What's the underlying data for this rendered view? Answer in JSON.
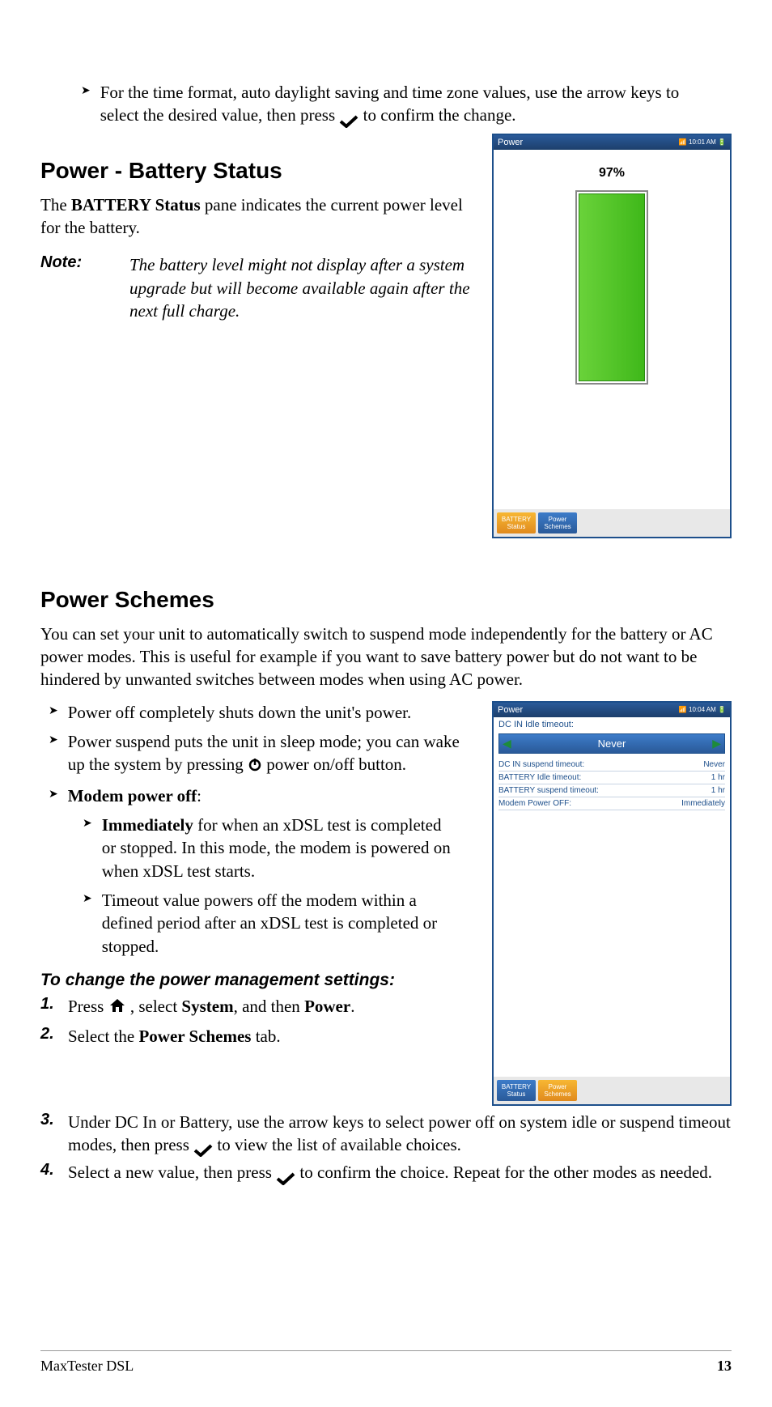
{
  "top_bullet": "For the time format, auto daylight saving and time zone values, use the arrow keys to select the desired value, then press ",
  "top_bullet_tail": " to confirm the change.",
  "h1": "Power - Battery Status",
  "battery_para_1": "The ",
  "battery_para_bold": "BATTERY Status",
  "battery_para_2": " pane indicates the current power level for the battery.",
  "note_label": "Note:",
  "note_text": "The battery level might not display after a system upgrade but will become available again after the next full charge.",
  "ss1": {
    "title": "Power",
    "time": "10:01 AM",
    "pct": "97%",
    "tab1": "BATTERY Status",
    "tab2": "Power Schemes"
  },
  "h2": "Power Schemes",
  "schemes_para": "You can set your unit to automatically switch to suspend mode independently for the battery or AC power modes. This is useful for example if you want to save battery power but do not want to be hindered by unwanted switches between modes when using AC power.",
  "sb1": "Power off completely shuts down the unit's power.",
  "sb2a": "Power suspend puts the unit in sleep mode; you can wake up the system by pressing",
  "sb2b": " power on/off button.",
  "sb3_bold": "Modem power off",
  "sb3_tail": ":",
  "sb3a_bold": "Immediately",
  "sb3a_tail": " for when an xDSL test is completed or stopped. In this mode, the modem is powered on when xDSL test starts.",
  "sb3b": "Timeout value powers off the modem within a defined period after an xDSL test is completed or stopped.",
  "instr_head": "To change the power management settings:",
  "step1a": "Press ",
  "step1b": " , select ",
  "step1_sys": "System",
  "step1c": ", and then ",
  "step1_pow": "Power",
  "step1d": ".",
  "step2a": "Select the ",
  "step2_bold": "Power Schemes",
  "step2b": " tab.",
  "step3a": "Under DC In or Battery, use the arrow keys to select power off on system idle or suspend timeout modes, then press ",
  "step3b": " to view the list of available choices.",
  "step4a": "Select a new value, then press ",
  "step4b": " to confirm the choice. Repeat for the other modes as needed.",
  "ss2": {
    "title": "Power",
    "time": "10:04 AM",
    "field_label": "DC IN Idle timeout:",
    "select_value": "Never",
    "rows": [
      {
        "k": "DC IN suspend timeout:",
        "v": "Never"
      },
      {
        "k": "BATTERY Idle timeout:",
        "v": "1 hr"
      },
      {
        "k": "BATTERY suspend timeout:",
        "v": "1 hr"
      },
      {
        "k": "Modem Power OFF:",
        "v": "Immediately"
      }
    ],
    "tab1": "BATTERY Status",
    "tab2": "Power Schemes"
  },
  "footer_left": "MaxTester DSL",
  "footer_right": "13"
}
